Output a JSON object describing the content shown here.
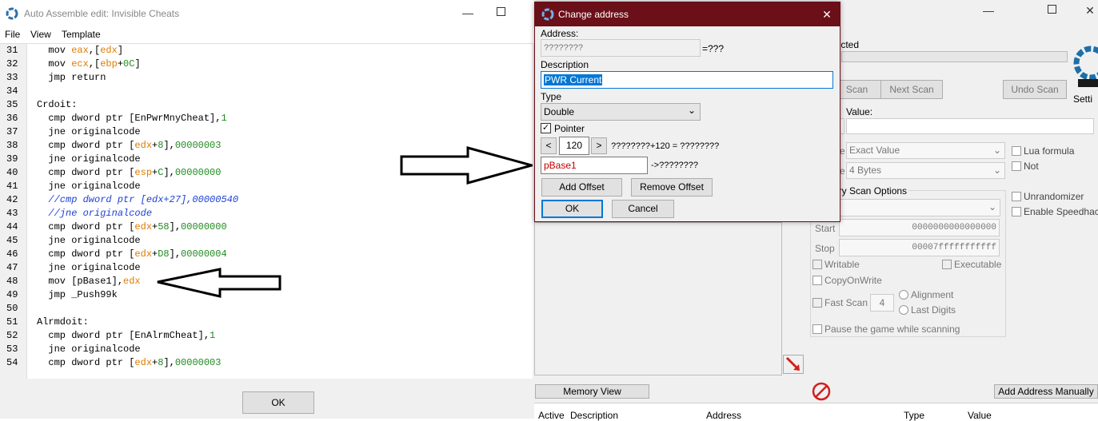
{
  "left_window": {
    "title": "Auto Assemble edit: Invisible Cheats",
    "menu": [
      "File",
      "View",
      "Template"
    ],
    "ok_label": "OK"
  },
  "code": {
    "lines": [
      {
        "n": "31",
        "segs": [
          [
            "kw",
            "  mov "
          ],
          [
            "reg",
            "eax"
          ],
          [
            "kw",
            ",["
          ],
          [
            "reg",
            "edx"
          ],
          [
            "kw",
            "]"
          ]
        ]
      },
      {
        "n": "32",
        "segs": [
          [
            "kw",
            "  mov "
          ],
          [
            "reg",
            "ecx"
          ],
          [
            "kw",
            ",["
          ],
          [
            "reg",
            "ebp"
          ],
          [
            "kw",
            "+"
          ],
          [
            "num",
            "0C"
          ],
          [
            "kw",
            "]"
          ]
        ]
      },
      {
        "n": "33",
        "segs": [
          [
            "kw",
            "  jmp return"
          ]
        ]
      },
      {
        "n": "34",
        "segs": []
      },
      {
        "n": "35",
        "segs": [
          [
            "kw",
            "Crdoit:"
          ]
        ]
      },
      {
        "n": "36",
        "segs": [
          [
            "kw",
            "  cmp dword ptr [EnPwrMnyCheat],"
          ],
          [
            "num",
            "1"
          ]
        ]
      },
      {
        "n": "37",
        "segs": [
          [
            "kw",
            "  jne originalcode"
          ]
        ]
      },
      {
        "n": "38",
        "segs": [
          [
            "kw",
            "  cmp dword ptr ["
          ],
          [
            "reg",
            "edx"
          ],
          [
            "kw",
            "+"
          ],
          [
            "num",
            "8"
          ],
          [
            "kw",
            "],"
          ],
          [
            "num",
            "00000003"
          ]
        ]
      },
      {
        "n": "39",
        "segs": [
          [
            "kw",
            "  jne originalcode"
          ]
        ]
      },
      {
        "n": "40",
        "segs": [
          [
            "kw",
            "  cmp dword ptr ["
          ],
          [
            "reg",
            "esp"
          ],
          [
            "kw",
            "+"
          ],
          [
            "num",
            "C"
          ],
          [
            "kw",
            "],"
          ],
          [
            "num",
            "00000000"
          ]
        ]
      },
      {
        "n": "41",
        "segs": [
          [
            "kw",
            "  jne originalcode"
          ]
        ]
      },
      {
        "n": "42",
        "segs": [
          [
            "cmt",
            "  //cmp dword ptr [edx+27],00000540"
          ]
        ]
      },
      {
        "n": "43",
        "segs": [
          [
            "cmt",
            "  //jne originalcode"
          ]
        ]
      },
      {
        "n": "44",
        "segs": [
          [
            "kw",
            "  cmp dword ptr ["
          ],
          [
            "reg",
            "edx"
          ],
          [
            "kw",
            "+"
          ],
          [
            "num",
            "58"
          ],
          [
            "kw",
            "],"
          ],
          [
            "num",
            "00000000"
          ]
        ]
      },
      {
        "n": "45",
        "segs": [
          [
            "kw",
            "  jne originalcode"
          ]
        ]
      },
      {
        "n": "46",
        "segs": [
          [
            "kw",
            "  cmp dword ptr ["
          ],
          [
            "reg",
            "edx"
          ],
          [
            "kw",
            "+"
          ],
          [
            "num",
            "D8"
          ],
          [
            "kw",
            "],"
          ],
          [
            "num",
            "00000004"
          ]
        ]
      },
      {
        "n": "47",
        "segs": [
          [
            "kw",
            "  jne originalcode"
          ]
        ]
      },
      {
        "n": "48",
        "segs": [
          [
            "kw",
            "  mov [pBase1],"
          ],
          [
            "reg",
            "edx"
          ]
        ]
      },
      {
        "n": "49",
        "segs": [
          [
            "kw",
            "  jmp _Push99k"
          ]
        ]
      },
      {
        "n": "50",
        "segs": []
      },
      {
        "n": "51",
        "segs": [
          [
            "kw",
            "Alrmdoit:"
          ]
        ]
      },
      {
        "n": "52",
        "segs": [
          [
            "kw",
            "  cmp dword ptr [EnAlrmCheat],"
          ],
          [
            "num",
            "1"
          ]
        ]
      },
      {
        "n": "53",
        "segs": [
          [
            "kw",
            "  jne originalcode"
          ]
        ]
      },
      {
        "n": "54",
        "segs": [
          [
            "kw",
            "  cmp dword ptr ["
          ],
          [
            "reg",
            "edx"
          ],
          [
            "kw",
            "+"
          ],
          [
            "num",
            "8"
          ],
          [
            "kw",
            "],"
          ],
          [
            "num",
            "00000003"
          ]
        ]
      }
    ]
  },
  "dialog": {
    "title": "Change address",
    "address_label": "Address:",
    "address_value": "????????",
    "address_result": "=???",
    "description_label": "Description",
    "description_value": "PWR Current",
    "type_label": "Type",
    "type_value": "Double",
    "pointer_label": "Pointer",
    "offset_prev": "<",
    "offset_value": "120",
    "offset_next": ">",
    "offset_formula": "????????+120 = ????????",
    "base_value": "pBase1",
    "base_result": "->????????",
    "add_offset": "Add Offset",
    "remove_offset": "Remove Offset",
    "ok": "OK",
    "cancel": "Cancel"
  },
  "main": {
    "selected_text": "lected",
    "first_scan": "Scan",
    "next_scan": "Next Scan",
    "undo_scan": "Undo Scan",
    "settings": "Setti",
    "value_label": "Value:",
    "scan_type_prefix": "e",
    "scan_type": "Exact Value",
    "value_type_prefix": "e",
    "value_type": "4 Bytes",
    "lua_formula": "Lua formula",
    "not_label": "Not",
    "memory_scan_options": "ory Scan Options",
    "unrandomizer": "Unrandomizer",
    "enable_speedhack": "Enable Speedhack",
    "start_label": "Start",
    "start_value": "0000000000000000",
    "stop_label": "Stop",
    "stop_value": "00007fffffffffff",
    "writable": "Writable",
    "executable": "Executable",
    "copy_on_write": "CopyOnWrite",
    "alignment": "Alignment",
    "last_digits": "Last Digits",
    "fast_scan": "Fast Scan",
    "fast_scan_value": "4",
    "pause_game": "Pause the game while scanning",
    "memory_view": "Memory View",
    "add_address": "Add Address Manually",
    "col_active": "Active",
    "col_description": "Description",
    "col_address": "Address",
    "col_type": "Type",
    "col_value": "Value"
  },
  "colors": {
    "dialog_title_bg": "#6b0f18",
    "register": "#e07b00",
    "number": "#1f8a1f",
    "comment": "#1c3fd6",
    "selection": "#0078d7"
  }
}
